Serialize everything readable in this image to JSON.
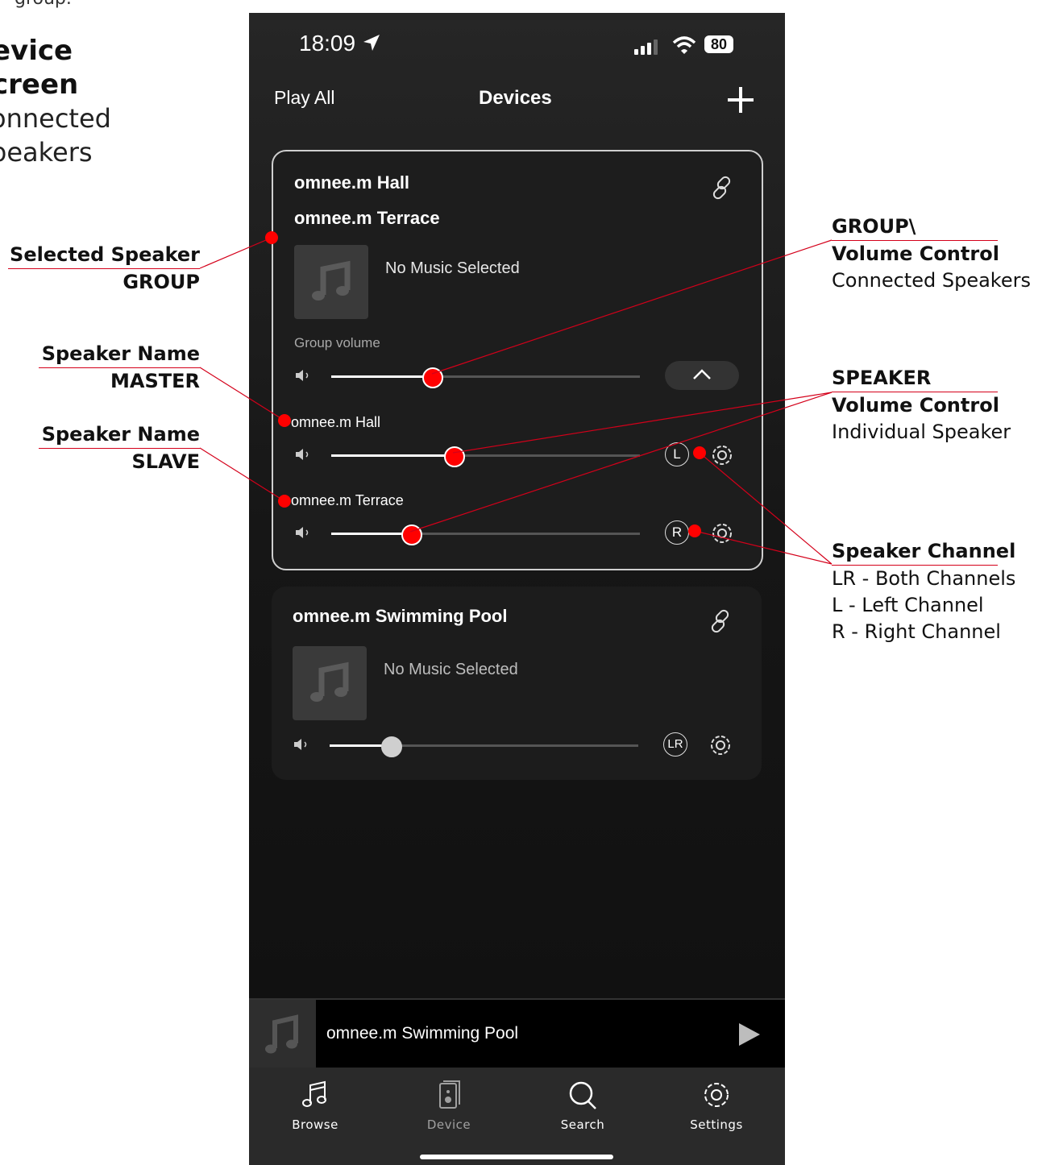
{
  "doc": {
    "intro_tail": "group.",
    "heading_line1": "evice",
    "heading_line2": "creen",
    "sub_line1": "onnected",
    "sub_line2": "peakers"
  },
  "annotations": {
    "selected_group": {
      "title": "Selected Speaker",
      "sub": "GROUP"
    },
    "master": {
      "title": "Speaker Name",
      "sub": "MASTER"
    },
    "slave": {
      "title": "Speaker Name",
      "sub": "SLAVE"
    },
    "group_volume": {
      "line1": "GROUP\\",
      "line2": "Volume Control",
      "line3": "Connected Speakers"
    },
    "speaker_volume": {
      "line1": "SPEAKER",
      "line2": "Volume Control",
      "line3": "Individual Speaker"
    },
    "channel": {
      "title": "Speaker Channel",
      "lines": [
        "LR - Both Channels",
        "L - Left Channel",
        "R - Right Channel"
      ]
    },
    "accent_color": "#d4001a"
  },
  "status_bar": {
    "time": "18:09",
    "battery": "80"
  },
  "nav": {
    "left": "Play All",
    "title": "Devices",
    "add_icon": "plus-icon"
  },
  "group_card": {
    "speaker1": "omnee.m Hall",
    "speaker2": "omnee.m Terrace",
    "now_playing": "No Music Selected",
    "group_volume_label": "Group volume",
    "group_volume": 0.33,
    "members": [
      {
        "name": "omnee.m Hall",
        "volume": 0.4,
        "channel": "L"
      },
      {
        "name": "omnee.m Terrace",
        "volume": 0.26,
        "channel": "R"
      }
    ]
  },
  "single_card": {
    "speaker": "omnee.m Swimming Pool",
    "now_playing": "No Music Selected",
    "volume": 0.2,
    "channel": "LR"
  },
  "player": {
    "title": "omnee.m Swimming Pool"
  },
  "tabs": [
    {
      "label": "Browse",
      "icon": "music-note-icon",
      "active": true
    },
    {
      "label": "Device",
      "icon": "speaker-icon",
      "active": false
    },
    {
      "label": "Search",
      "icon": "search-icon",
      "active": true
    },
    {
      "label": "Settings",
      "icon": "gear-icon",
      "active": true
    }
  ]
}
